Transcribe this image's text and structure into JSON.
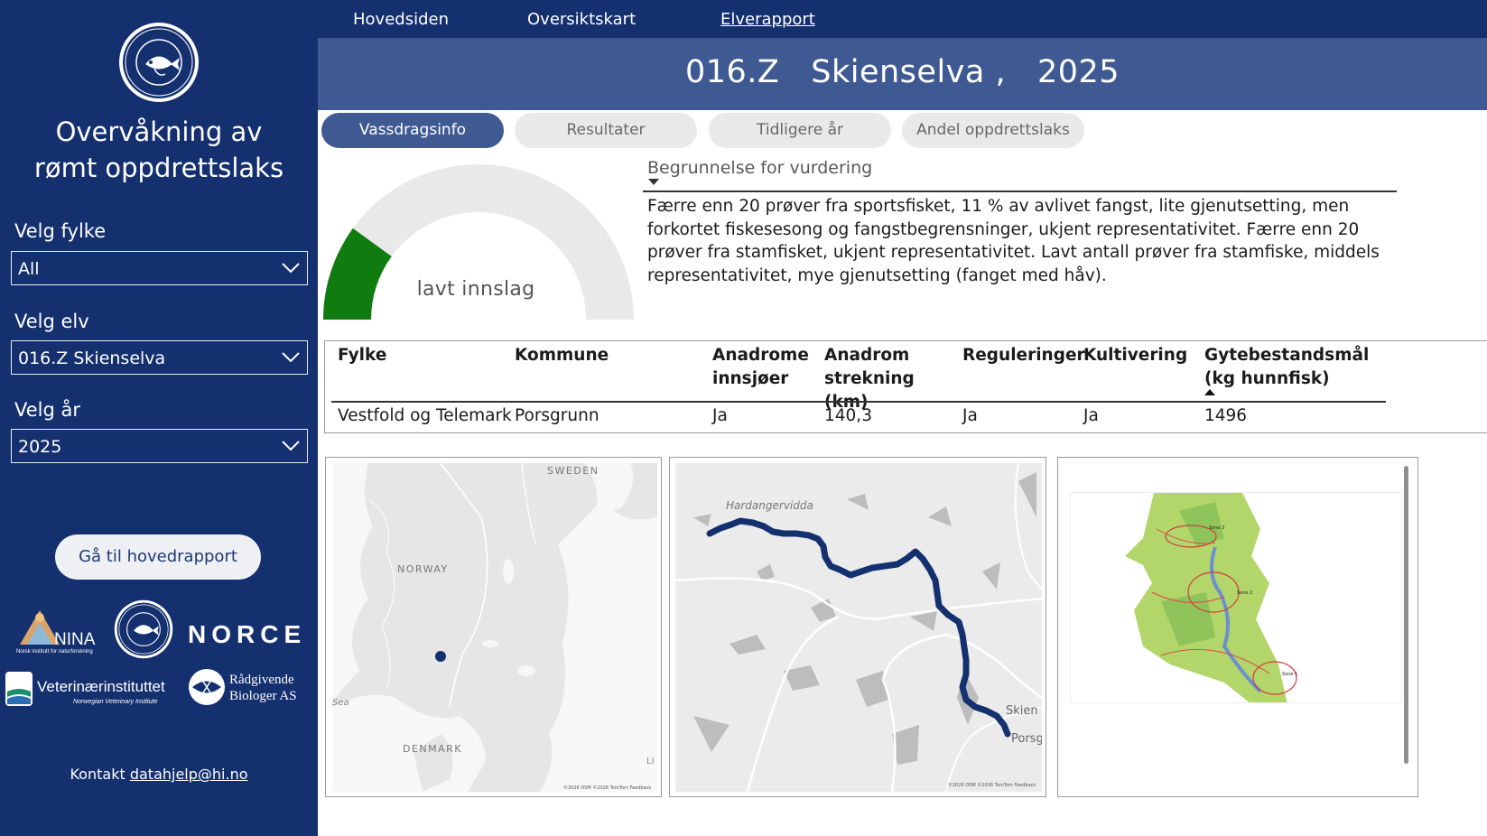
{
  "sidebar": {
    "title_line1": "Overvåkning av",
    "title_line2": "rømt oppdrettslaks",
    "filters": [
      {
        "label": "Velg fylke",
        "value": "All"
      },
      {
        "label": "Velg elv",
        "value": "016.Z Skienselva"
      },
      {
        "label": "Velg år",
        "value": "2025"
      }
    ],
    "main_report_button": "Gå til hovedrapport",
    "partners": {
      "nina": "NINA",
      "nina_sub": "Norsk institutt for naturforskning",
      "norce": "NORCE",
      "vet": "Veterinærinstituttet",
      "vet_sub": "Norwegian Veterinary Institute",
      "rb_line1": "Rådgivende",
      "rb_line2": "Biologer AS"
    },
    "contact_label": "Kontakt",
    "contact_email": "datahjelp@hi.no"
  },
  "nav": {
    "items": [
      "Hovedsiden",
      "Oversiktskart",
      "Elverapport"
    ],
    "active": "Elverapport"
  },
  "header": {
    "title": "016.Z   Skienselva ,   2025"
  },
  "tabs": [
    {
      "label": "Vassdragsinfo",
      "active": true
    },
    {
      "label": "Resultater",
      "active": false
    },
    {
      "label": "Tidligere år",
      "active": false
    },
    {
      "label": "Andel oppdrettslaks",
      "active": false
    }
  ],
  "gauge": {
    "label": "lavt innslag",
    "level_fraction": 0.2,
    "fill_color": "#107c10",
    "track_color": "#e9e9e9"
  },
  "reason": {
    "title": "Begrunnelse for vurdering",
    "text": "Færre enn 20 prøver fra sportsfisket, 11 % av avlivet fangst, lite gjenutsetting, men forkortet fiskesesong og fangstbegrensninger, ukjent representativitet. Færre enn 20 prøver fra stamfisket, ukjent representativitet. Lavt antall prøver fra stamfiske, middels representativitet, mye gjenutsetting (fanget med håv)."
  },
  "river_table": {
    "headers": [
      "Fylke",
      "Kommune",
      "Anadrome innsjøer",
      "Anadrom strekning (km)",
      "Reguleringer",
      "Kultivering",
      "Gytebestandsmål (kg hunnfisk)"
    ],
    "row": [
      "Vestfold og Telemark",
      "Porsgrunn",
      "Ja",
      "140,3",
      "Ja",
      "Ja",
      "1496"
    ]
  },
  "map_overview": {
    "labels": [
      "SWEDEN",
      "NORWAY",
      "DENMARK",
      "Sea",
      "LI"
    ],
    "attribution": "©2026 OSM ©2026 TomTom Feedback"
  },
  "map_river": {
    "labels": [
      "Hardangervidda",
      "Skien",
      "Porsg"
    ],
    "attribution": "©2026 OSM ©2026 TomTom Feedback",
    "route_color": "#14306f"
  },
  "map_zones": {
    "zones": [
      "Sone 3",
      "Sone 2",
      "Sone 1"
    ]
  }
}
